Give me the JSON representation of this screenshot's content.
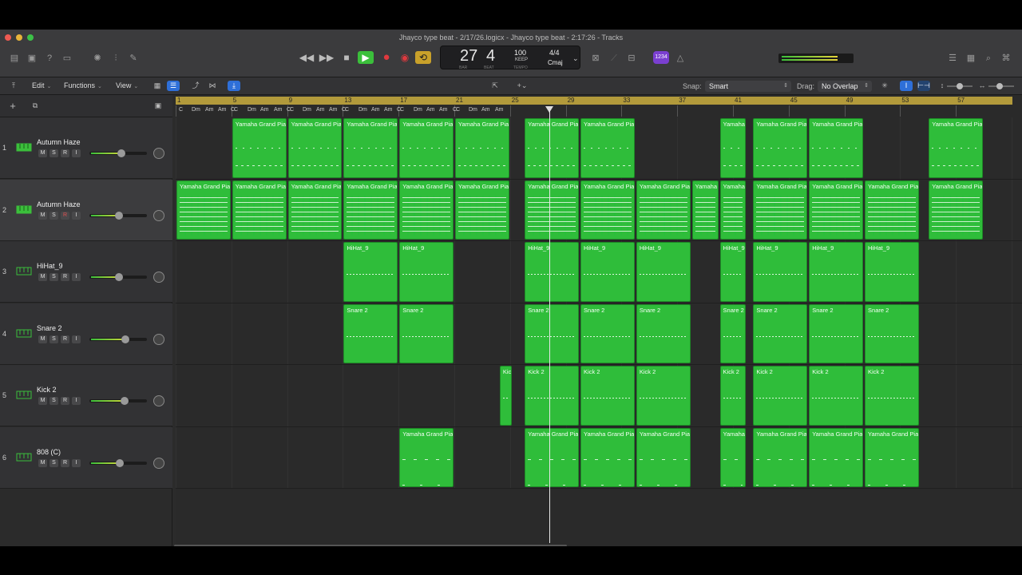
{
  "window": {
    "title": "Jhayco type beat - 2/17/26.logicx - Jhayco type beat - 2:17:26 - Tracks"
  },
  "lcd": {
    "bar": "27",
    "beat": "4",
    "bar_label": "BAR",
    "beat_label": "BEAT",
    "tempo": "100",
    "tempo_mode": "KEEP",
    "tempo_label": "TEMPO",
    "time_signature": "4/4",
    "key": "Cmaj"
  },
  "count_in_badge": "1234",
  "menu": {
    "edit": "Edit",
    "functions": "Functions",
    "view": "View",
    "snap_label": "Snap:",
    "snap_value": "Smart",
    "drag_label": "Drag:",
    "drag_value": "No Overlap"
  },
  "ruler": {
    "bars": [
      "1",
      "5",
      "9",
      "13",
      "17",
      "21",
      "25",
      "29",
      "33",
      "37",
      "41",
      "45",
      "49",
      "53",
      "57"
    ],
    "chords": [
      "C",
      "Dm",
      "Am",
      "Am",
      "C",
      "C",
      "Dm",
      "Am",
      "Am",
      "C",
      "C",
      "Dm",
      "Am",
      "Am",
      "C",
      "C",
      "Dm",
      "Am",
      "Am",
      "C",
      "C",
      "Dm",
      "Am",
      "Am",
      "C",
      "C",
      "Dm",
      "Am",
      "Am"
    ]
  },
  "tracks": [
    {
      "number": "1",
      "name": "Autumn Haze",
      "buttons": [
        "M",
        "S",
        "R",
        "I"
      ],
      "volume": 0.55
    },
    {
      "number": "2",
      "name": "Autumn Haze",
      "buttons": [
        "M",
        "S",
        "R",
        "I"
      ],
      "volume": 0.5
    },
    {
      "number": "3",
      "name": "HiHat_9",
      "buttons": [
        "M",
        "S",
        "R",
        "I"
      ],
      "volume": 0.5
    },
    {
      "number": "4",
      "name": "Snare 2",
      "buttons": [
        "M",
        "S",
        "R",
        "I"
      ],
      "volume": 0.62
    },
    {
      "number": "5",
      "name": "Kick 2",
      "buttons": [
        "M",
        "S",
        "R",
        "I"
      ],
      "volume": 0.6
    },
    {
      "number": "6",
      "name": "808 (C)",
      "buttons": [
        "M",
        "S",
        "R",
        "I"
      ],
      "volume": 0.52
    }
  ],
  "regions": {
    "piano": "Yamaha Grand Pia",
    "piano_short": "Yamaha",
    "hihat": "HiHat_9",
    "snare": "Snare 2",
    "kick": "Kick 2",
    "kick_short": "Kic"
  },
  "colors": {
    "region_green": "#2fbd3a",
    "ruler_gold": "#b29a3b",
    "accent_blue": "#2e6fd8",
    "play_green": "#3bbf3b",
    "record_red": "#e0393e"
  }
}
